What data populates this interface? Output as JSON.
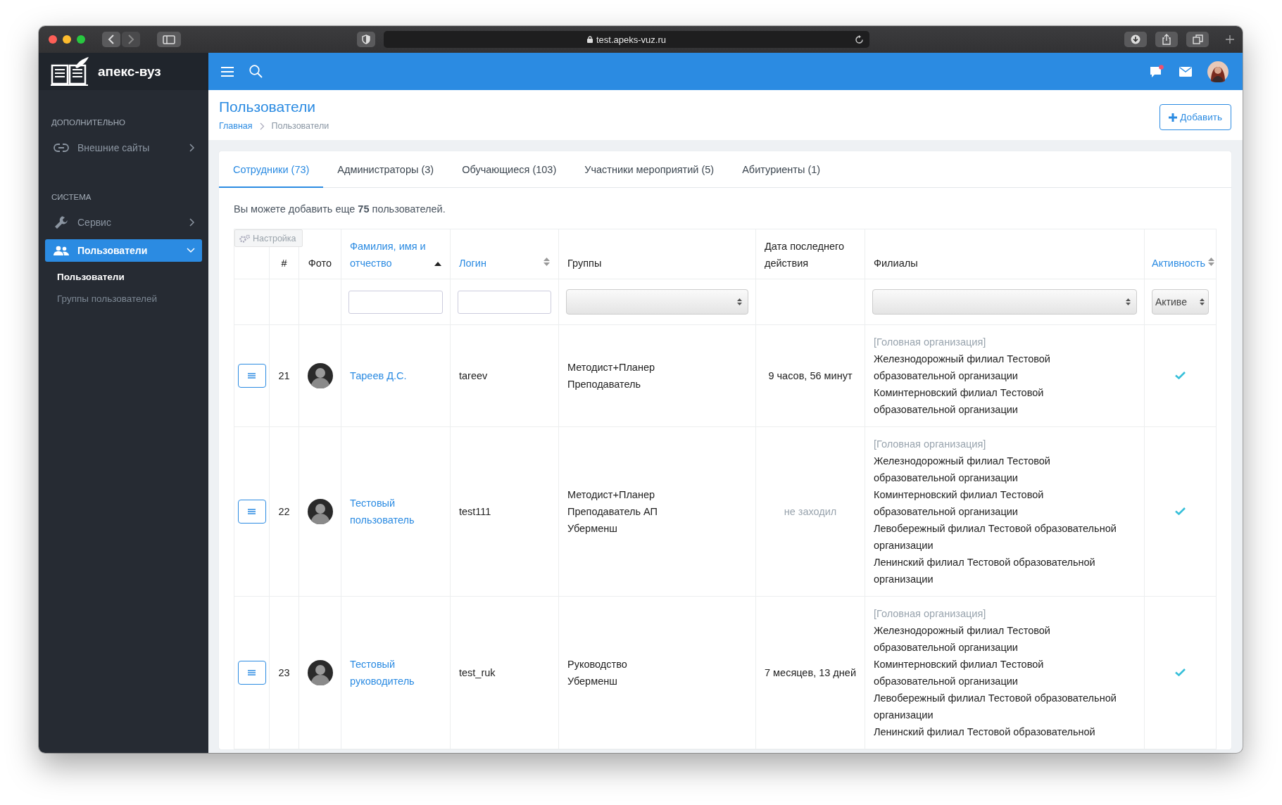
{
  "window": {
    "url": "test.apeks-vuz.ru"
  },
  "brand": "апекс-вуз",
  "sidebar": {
    "sections": [
      {
        "title": "ДОПОЛНИТЕЛЬНО",
        "items": [
          {
            "label": "Внешние сайты",
            "kind": "link",
            "selected": false,
            "expanded": false
          }
        ]
      },
      {
        "title": "СИСТЕМА",
        "items": [
          {
            "label": "Сервис",
            "kind": "wrench",
            "selected": false,
            "expanded": false
          },
          {
            "label": "Пользователи",
            "kind": "users",
            "selected": true,
            "expanded": true,
            "children": [
              {
                "label": "Пользователи",
                "selected": true
              },
              {
                "label": "Группы пользователей",
                "selected": false
              }
            ]
          }
        ]
      }
    ]
  },
  "topbar": {
    "unread_messages": true
  },
  "page": {
    "title": "Пользователи",
    "breadcrumbs": [
      "Главная",
      "Пользователи"
    ],
    "add_button": "Добавить"
  },
  "tabs": [
    {
      "label": "Сотрудники (73)",
      "selected": true
    },
    {
      "label": "Администраторы (3)",
      "selected": false
    },
    {
      "label": "Обучающиеся (103)",
      "selected": false
    },
    {
      "label": "Участники мероприятий (5)",
      "selected": false
    },
    {
      "label": "Абитуриенты (1)",
      "selected": false
    }
  ],
  "notice": "Вы можете добавить еще **75** пользователей.",
  "table": {
    "settings_button": "Настройка",
    "columns": [
      {
        "label": "#",
        "sortable": false
      },
      {
        "label": "Фото",
        "sortable": false
      },
      {
        "label": "Фамилия, имя и отчество",
        "sortable": true,
        "sorted": true
      },
      {
        "label": "Логин",
        "sortable": true,
        "sorted": false
      },
      {
        "label": "Группы",
        "sortable": false
      },
      {
        "label": "Дата последнего действия",
        "sortable": false
      },
      {
        "label": "Филиалы",
        "sortable": false
      },
      {
        "label": "Активность",
        "sortable": true,
        "sorted": false
      }
    ],
    "filters": [
      {
        "kind": "none"
      },
      {
        "kind": "none"
      },
      {
        "kind": "none"
      },
      {
        "kind": "text"
      },
      {
        "kind": "text"
      },
      {
        "kind": "select"
      },
      {
        "kind": "none"
      },
      {
        "kind": "select"
      },
      {
        "kind": "select",
        "value": "Активе"
      }
    ],
    "rows": [
      {
        "number": "21",
        "name": "Тареев Д.С.",
        "login": "tareev",
        "groups": [
          "Методист+Планер",
          "Преподаватель"
        ],
        "last_action": "9 часов, 56 минут",
        "never_logged_in": false,
        "branches_head": "[Головная организация]",
        "branches": [
          "Железнодорожный филиал Тестовой образовательной организации",
          "Коминтерновский филиал Тестовой образовательной организации"
        ],
        "active": true
      },
      {
        "number": "22",
        "name": "Тестовый пользователь",
        "login": "test111",
        "groups": [
          "Методист+Планер",
          "Преподаватель АП",
          "Уберменш"
        ],
        "last_action": "не заходил",
        "never_logged_in": true,
        "branches_head": "[Головная организация]",
        "branches": [
          "Железнодорожный филиал Тестовой образовательной организации",
          "Коминтерновский филиал Тестовой образовательной организации",
          "Левобережный филиал Тестовой образовательной организации",
          "Ленинский филиал Тестовой образовательной организации"
        ],
        "active": true
      },
      {
        "number": "23",
        "name": "Тестовый руководитель",
        "login": "test_ruk",
        "groups": [
          "Руководство",
          "Уберменш"
        ],
        "last_action": "7 месяцев, 13 дней",
        "never_logged_in": false,
        "branches_head": "[Головная организация]",
        "branches": [
          "Железнодорожный филиал Тестовой образовательной организации",
          "Коминтерновский филиал Тестовой образовательной организации",
          "Левобережный филиал Тестовой образовательной организации",
          "Ленинский филиал Тестовой образовательной"
        ],
        "active": true
      }
    ]
  }
}
